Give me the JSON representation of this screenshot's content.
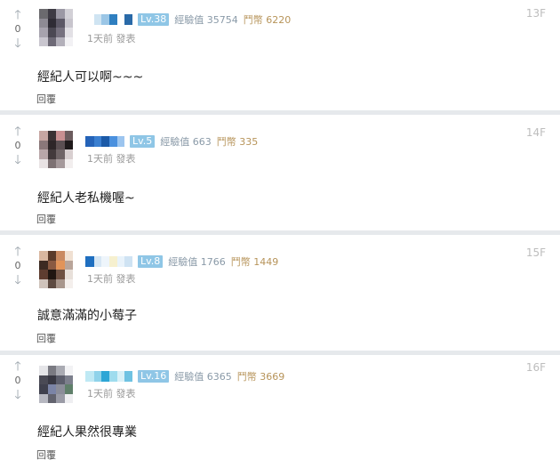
{
  "comments": [
    {
      "upvote_icon": "arrow-up-icon",
      "downvote_icon": "arrow-down-icon",
      "vote_count": "0",
      "level": "Lv.38",
      "exp": "經驗值 35754",
      "gp": "鬥幣 6220",
      "time": "1天前 發表",
      "floor": "13F",
      "text": "經紀人可以啊~~~",
      "reply_label": "回覆",
      "avatar_colors": [
        "#6b6a6e",
        "#3e3b44",
        "#9b98a4",
        "#d2d0d6",
        "#8e8b94",
        "#2f2c35",
        "#5c5866",
        "#c8c5cd",
        "#a7a3ae",
        "#4b4853",
        "#76717f",
        "#e2e0e5",
        "#c9c6cf",
        "#6d6976",
        "#b3b0ba",
        "#f2f1f4"
      ],
      "name_colors": [
        "#ffffff",
        "#cfe4f2",
        "#9bc6e6",
        "#2f7fc0",
        "#ffffff",
        "#2a6aa8"
      ]
    },
    {
      "upvote_icon": "arrow-up-icon",
      "downvote_icon": "arrow-down-icon",
      "vote_count": "0",
      "level": "Lv.5",
      "exp": "經驗值 663",
      "gp": "鬥幣 335",
      "time": "1天前 發表",
      "floor": "14F",
      "text": "經紀人老私機喔~",
      "reply_label": "回覆",
      "avatar_colors": [
        "#c7a6a2",
        "#3b3133",
        "#c88f91",
        "#6c5c5e",
        "#8a7779",
        "#2e2628",
        "#5b4f52",
        "#1f1a1b",
        "#b9a7a9",
        "#433a3c",
        "#6f6466",
        "#d8cfd0",
        "#e9e3e4",
        "#7d7173",
        "#a5999b",
        "#f2eeee"
      ],
      "name_colors": [
        "#2563b8",
        "#3a7fd0",
        "#1b5aa8",
        "#4a90de",
        "#9cc5ef"
      ]
    },
    {
      "upvote_icon": "arrow-up-icon",
      "downvote_icon": "arrow-down-icon",
      "vote_count": "0",
      "level": "Lv.8",
      "exp": "經驗值 1766",
      "gp": "鬥幣 1449",
      "time": "1天前 發表",
      "floor": "15F",
      "text": "誠意滿滿的小莓子",
      "reply_label": "回覆",
      "avatar_colors": [
        "#d9b7a0",
        "#5a3a2a",
        "#c98a62",
        "#f0e0d2",
        "#3c2a22",
        "#8a5a42",
        "#e2945a",
        "#b9a59a",
        "#5e3d30",
        "#201611",
        "#6f5142",
        "#e8e0da",
        "#cfc3bb",
        "#5d4a41",
        "#a8968c",
        "#f4efec"
      ],
      "name_colors": [
        "#1f6fc0",
        "#d7e7f4",
        "#eef5fb",
        "#f6f0cf",
        "#e9f3fb",
        "#cfe3f3"
      ]
    },
    {
      "upvote_icon": "arrow-up-icon",
      "downvote_icon": "arrow-down-icon",
      "vote_count": "0",
      "level": "Lv.16",
      "exp": "經驗值 6365",
      "gp": "鬥幣 3669",
      "time": "1天前 發表",
      "floor": "16F",
      "text": "經紀人果然很專業",
      "reply_label": "回覆",
      "avatar_colors": [
        "#e5e5e8",
        "#7a7a82",
        "#a9aab2",
        "#f2f2f4",
        "#4a4a55",
        "#393944",
        "#5c5e6c",
        "#7c7f8c",
        "#3f404d",
        "#7b84a6",
        "#8b8d99",
        "#5f7f6a",
        "#b6b7c0",
        "#62636e",
        "#9a9ba6",
        "#eeeef1"
      ],
      "name_colors": [
        "#bfe9f4",
        "#8fd3ea",
        "#2ea6d6",
        "#9fdcee",
        "#d9f1f8",
        "#6fc2e2"
      ]
    }
  ]
}
